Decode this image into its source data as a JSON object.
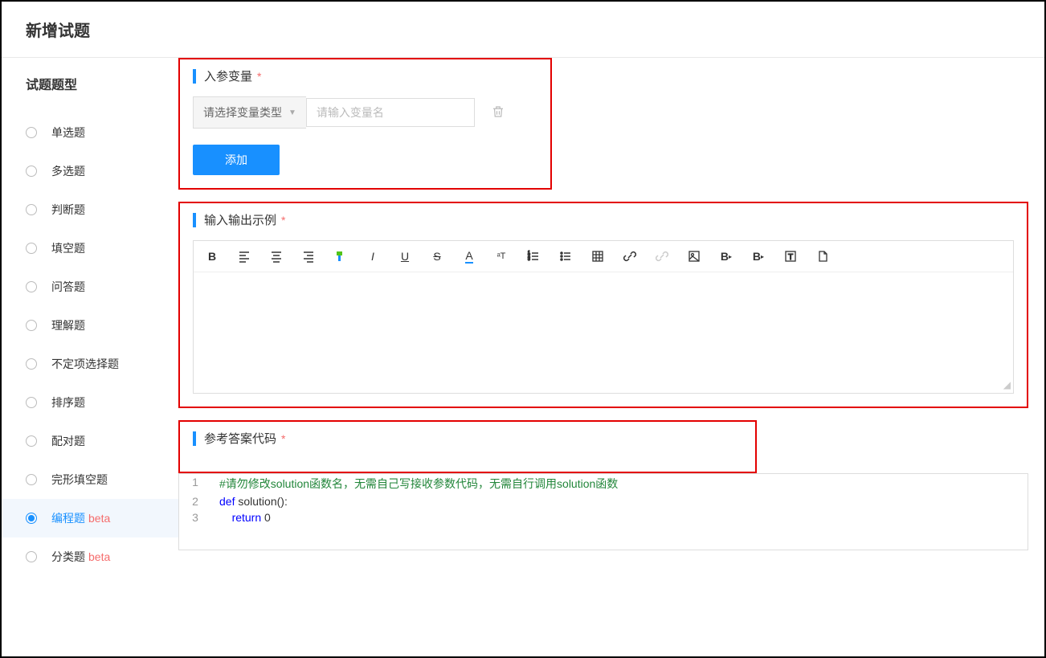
{
  "header": {
    "title": "新增试题"
  },
  "sidebar": {
    "title": "试题题型",
    "types": [
      {
        "label": "单选题",
        "beta": false,
        "active": false
      },
      {
        "label": "多选题",
        "beta": false,
        "active": false
      },
      {
        "label": "判断题",
        "beta": false,
        "active": false
      },
      {
        "label": "填空题",
        "beta": false,
        "active": false
      },
      {
        "label": "问答题",
        "beta": false,
        "active": false
      },
      {
        "label": "理解题",
        "beta": false,
        "active": false
      },
      {
        "label": "不定项选择题",
        "beta": false,
        "active": false
      },
      {
        "label": "排序题",
        "beta": false,
        "active": false
      },
      {
        "label": "配对题",
        "beta": false,
        "active": false
      },
      {
        "label": "完形填空题",
        "beta": false,
        "active": false
      },
      {
        "label": "编程题",
        "beta": true,
        "active": true
      },
      {
        "label": "分类题",
        "beta": true,
        "active": false
      }
    ],
    "beta_tag": "beta"
  },
  "sections": {
    "params": {
      "title": "入参变量",
      "type_placeholder": "请选择变量类型",
      "name_placeholder": "请输入变量名",
      "add_label": "添加"
    },
    "io": {
      "title": "输入输出示例"
    },
    "answer": {
      "title": "参考答案代码",
      "code": {
        "line1": "#请勿修改solution函数名，无需自己写接收参数代码，无需自行调用solution函数",
        "line2_kw": "def",
        "line2_rest": " solution():",
        "line3_kw": "return",
        "line3_rest": " 0",
        "nums": [
          "1",
          "2",
          "3"
        ]
      }
    }
  }
}
